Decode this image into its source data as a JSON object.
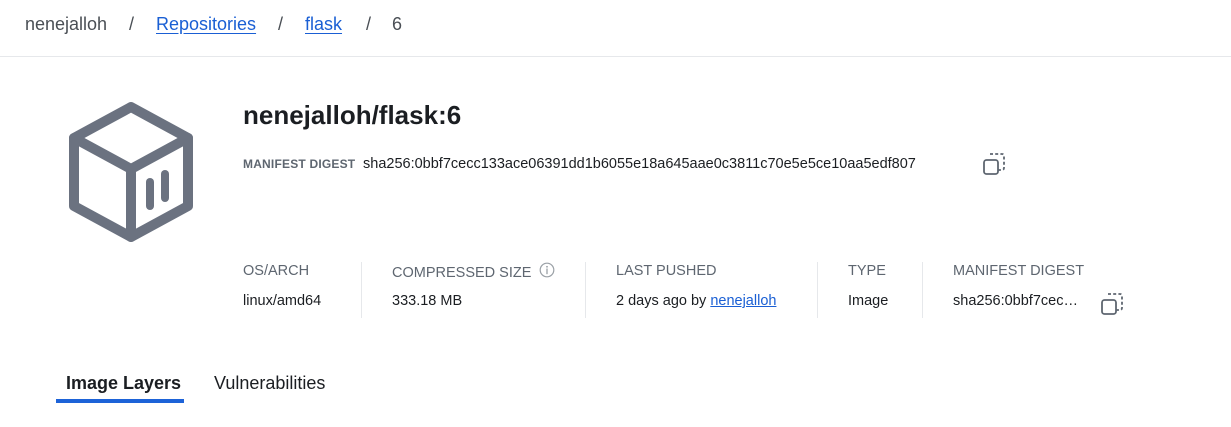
{
  "breadcrumb": {
    "user": "nenejalloh",
    "sep": "/",
    "repositories": "Repositories",
    "repo": "flask",
    "tag": "6"
  },
  "header": {
    "title": "nenejalloh/flask:6",
    "digest_label": "MANIFEST DIGEST",
    "digest_value": "sha256:0bbf7cecc133ace06391dd1b6055e18a645aae0c3811c70e5e5ce10aa5edf807"
  },
  "meta": {
    "os_arch": {
      "label": "OS/ARCH",
      "value": "linux/amd64"
    },
    "compressed_size": {
      "label": "COMPRESSED SIZE",
      "value": "333.18 MB"
    },
    "last_pushed": {
      "label": "LAST PUSHED",
      "value_prefix": "2 days ago by",
      "user": "nenejalloh"
    },
    "type": {
      "label": "TYPE",
      "value": "Image"
    },
    "manifest_digest": {
      "label": "MANIFEST DIGEST",
      "value": "sha256:0bbf7cec…"
    }
  },
  "tabs": [
    {
      "label": "Image Layers",
      "active": true
    },
    {
      "label": "Vulnerabilities",
      "active": false
    }
  ],
  "icons": {
    "repo": "container-box-icon",
    "copy": "copy-icon",
    "info": "info-circle-icon"
  },
  "colors": {
    "link": "#1a5fd4",
    "tab_accent": "#1d63d8",
    "icon_gray": "#6b7280"
  }
}
